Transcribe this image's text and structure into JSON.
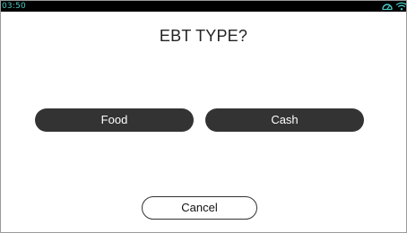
{
  "status_bar": {
    "time": "03:50",
    "icons": [
      "gauge-icon",
      "wifi-icon"
    ],
    "accent_color": "#49c9c3"
  },
  "dialog": {
    "title": "EBT TYPE?",
    "options": [
      "Food",
      "Cash"
    ],
    "cancel_label": "Cancel"
  },
  "colors": {
    "button_dark": "#333333",
    "button_text_light": "#ffffff",
    "background": "#ffffff"
  }
}
